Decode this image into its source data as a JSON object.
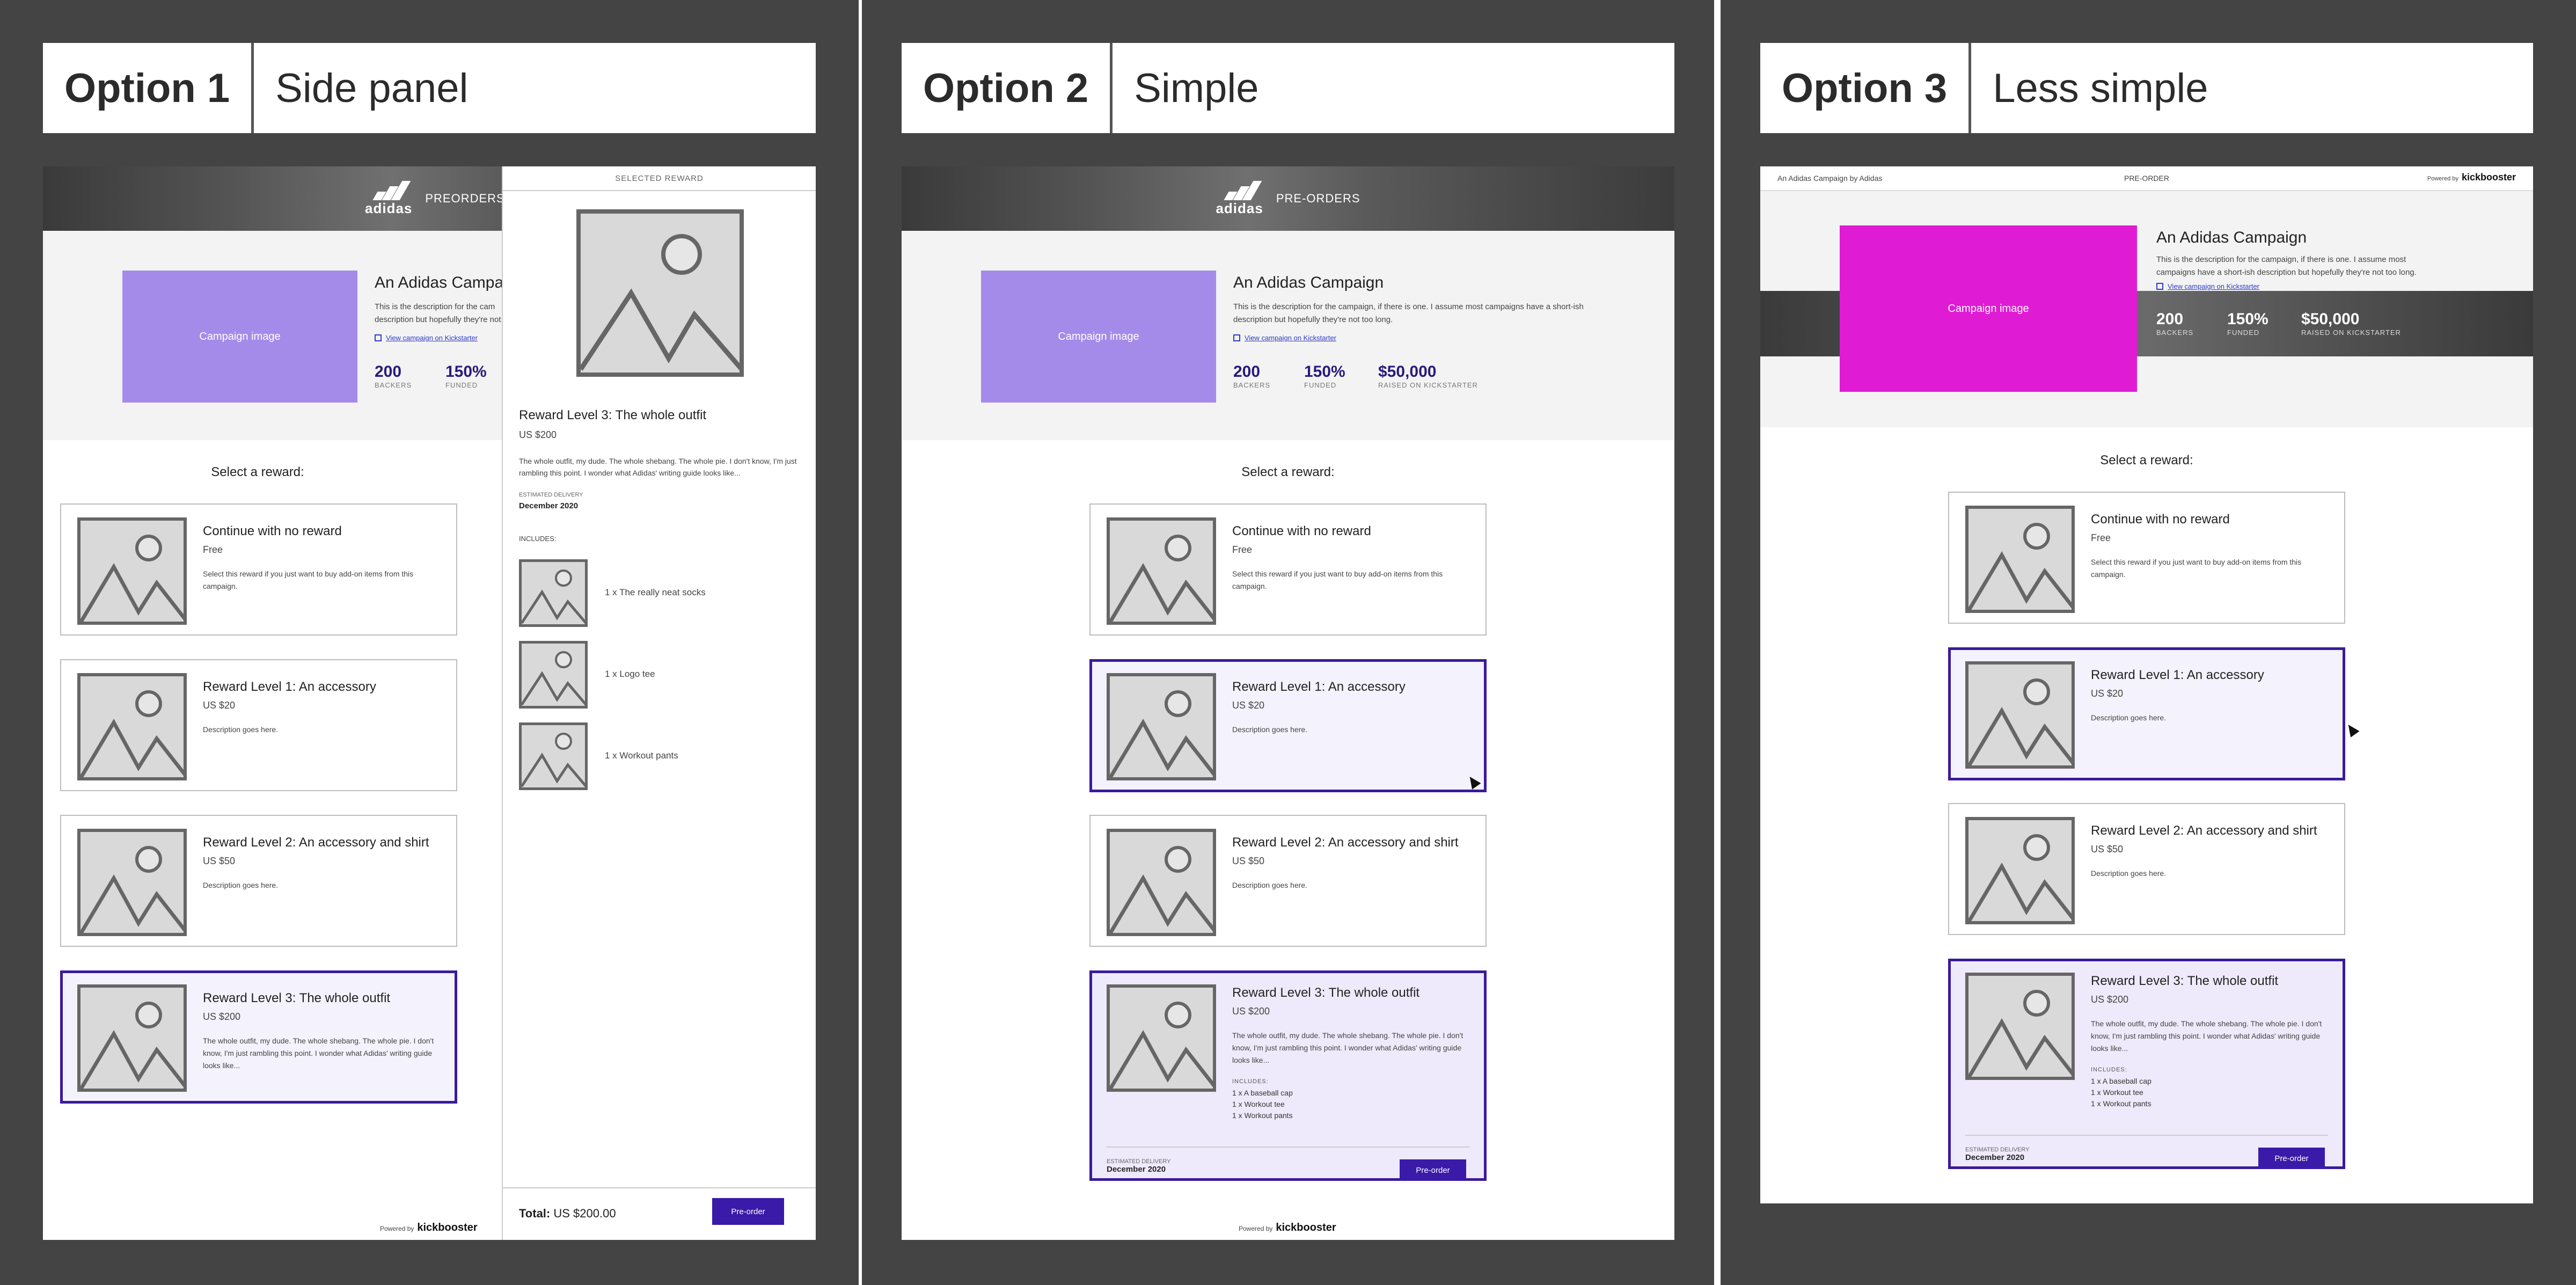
{
  "options": [
    {
      "num": "Option 1",
      "name": "Side panel"
    },
    {
      "num": "Option 2",
      "name": "Simple"
    },
    {
      "num": "Option 3",
      "name": "Less simple"
    }
  ],
  "banner": {
    "logo": "adidas",
    "preorders": "PREORDERS",
    "pre_orders": "PRE-ORDERS"
  },
  "topbar3": {
    "left": "An Adidas Campaign by Adidas",
    "center": "PRE-ORDER",
    "powered": "Powered by",
    "brand": "kickbooster"
  },
  "campaign": {
    "image_label": "Campaign image",
    "title": "An Adidas Campaign",
    "title_cut": "An Adidas Campaig",
    "desc": "This is the description for the campaign, if there is one. I assume most campaigns have a short-ish description but hopefully they're not too long.",
    "desc_cut_1": "This is the description for the cam",
    "desc_cut_2": "description but hopefully they're not",
    "link": "View campaign on Kickstarter",
    "stats": [
      {
        "num": "200",
        "label": "BACKERS"
      },
      {
        "num": "150%",
        "label": "FUNDED"
      },
      {
        "num": "$50,000",
        "label": "RAISED ON KICKSTARTER"
      }
    ]
  },
  "select_label": "Select a reward:",
  "rewards": [
    {
      "title": "Continue with no reward",
      "price": "Free",
      "desc": "Select this reward if you just want to buy add-on items from this campaign."
    },
    {
      "title": "Reward Level 1: An accessory",
      "price": "US $20",
      "desc": "Description goes here."
    },
    {
      "title": "Reward Level 2: An accessory and shirt",
      "price": "US $50",
      "desc": "Description goes here."
    },
    {
      "title": "Reward Level 3: The whole outfit",
      "price": "US $200",
      "desc": "The whole outfit, my dude. The whole shebang. The whole pie. I don't know, I'm just rambling this point. I wonder what Adidas' writing guide looks like..."
    }
  ],
  "includes": {
    "label": "INCLUDES:",
    "items": [
      "1 x A baseball cap",
      "1 x Workout tee",
      "1 x Workout pants"
    ]
  },
  "delivery": {
    "label": "ESTIMATED DELIVERY",
    "value": "December 2020"
  },
  "preorder_btn": "Pre-order",
  "powered": {
    "text": "Powered by",
    "brand": "kickbooster"
  },
  "side_panel": {
    "header": "SELECTED REWARD",
    "title": "Reward Level 3: The whole outfit",
    "price": "US $200",
    "desc": "The whole outfit, my dude. The whole shebang. The whole pie. I don't know, I'm just rambling this point. I wonder what Adidas' writing guide looks like...",
    "delivery_label": "ESTIMATED DELIVERY",
    "delivery_value": "December 2020",
    "includes_label": "INCLUDES:",
    "items": [
      "1 x The really neat socks",
      "1 x Logo tee",
      "1 x Workout pants"
    ],
    "total_label": "Total:",
    "total_value": "US $200.00",
    "button": "Pre-order"
  },
  "colors": {
    "accent": "#3a1aa8",
    "campaign_img_1": "#a48bea",
    "campaign_img_3": "#e01bd4",
    "bg": "#444444"
  }
}
